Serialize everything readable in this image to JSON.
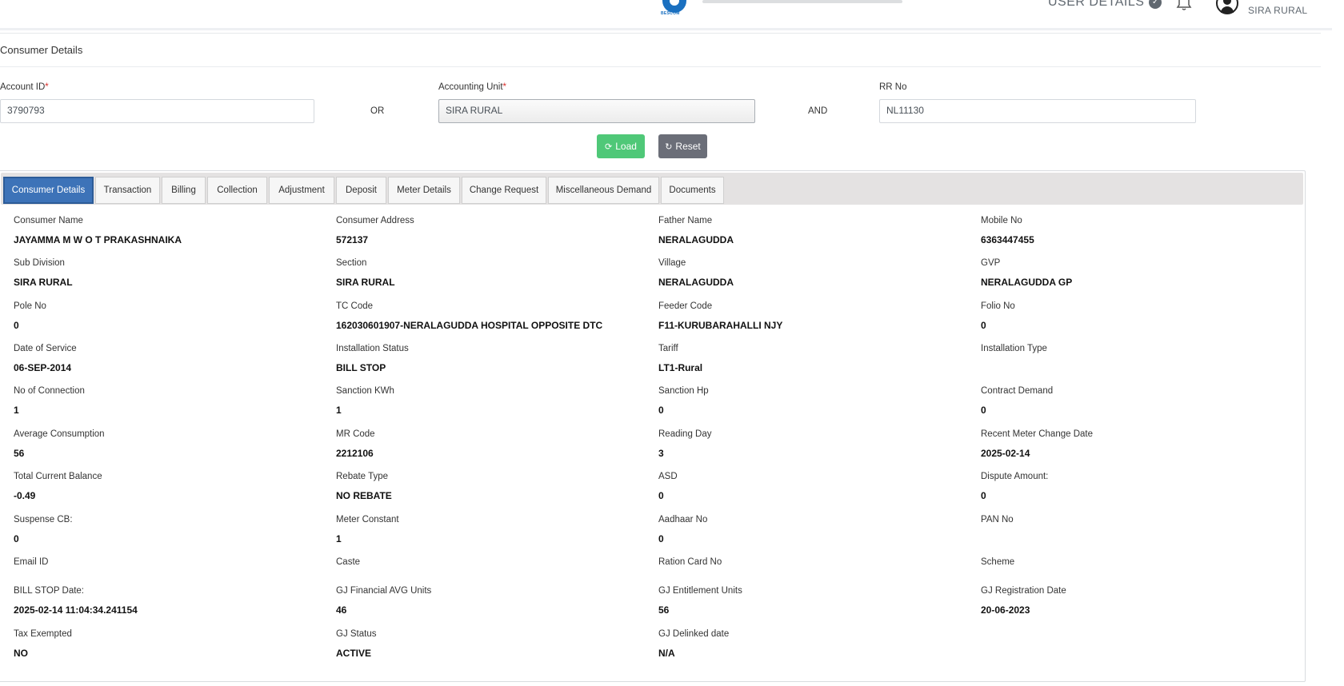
{
  "header": {
    "logo_tag": "BESCOM",
    "user_details_label": "USER DETAILS",
    "user_sub": "SIRA RURAL"
  },
  "page": {
    "title": "Consumer Details"
  },
  "search": {
    "account_id_label": "Account ID",
    "account_id_value": "3790793",
    "or_label": "OR",
    "accounting_unit_label": "Accounting Unit",
    "accounting_unit_value": "SIRA RURAL",
    "and_label": "AND",
    "rr_no_label": "RR No",
    "rr_no_value": "NL11130",
    "load_label": "Load",
    "reset_label": "Reset"
  },
  "tabs": [
    {
      "label": "Consumer Details",
      "active": true
    },
    {
      "label": "Transaction"
    },
    {
      "label": "Billing"
    },
    {
      "label": "Collection"
    },
    {
      "label": "Adjustment"
    },
    {
      "label": "Deposit"
    },
    {
      "label": "Meter Details"
    },
    {
      "label": "Change Request"
    },
    {
      "label": "Miscellaneous Demand"
    },
    {
      "label": "Documents"
    }
  ],
  "fields": [
    {
      "label": "Consumer Name",
      "value": "JAYAMMA M W O T PRAKASHNAIKA"
    },
    {
      "label": "Consumer Address",
      "value": "572137"
    },
    {
      "label": "Father Name",
      "value": "NERALAGUDDA"
    },
    {
      "label": "Mobile No",
      "value": "6363447455"
    },
    {
      "label": "Sub Division",
      "value": "SIRA RURAL"
    },
    {
      "label": "Section",
      "value": "SIRA RURAL"
    },
    {
      "label": "Village",
      "value": "NERALAGUDDA"
    },
    {
      "label": "GVP",
      "value": "NERALAGUDDA GP"
    },
    {
      "label": "Pole No",
      "value": "0"
    },
    {
      "label": "TC Code",
      "value": "162030601907-NERALAGUDDA HOSPITAL OPPOSITE DTC"
    },
    {
      "label": "Feeder Code",
      "value": "F11-KURUBARAHALLI NJY"
    },
    {
      "label": "Folio No",
      "value": "0"
    },
    {
      "label": "Date of Service",
      "value": "06-SEP-2014"
    },
    {
      "label": "Installation Status",
      "value": "BILL STOP"
    },
    {
      "label": "Tariff",
      "value": "LT1-Rural"
    },
    {
      "label": "Installation Type",
      "value": ""
    },
    {
      "label": "No of Connection",
      "value": "1"
    },
    {
      "label": "Sanction KWh",
      "value": "1"
    },
    {
      "label": "Sanction Hp",
      "value": "0"
    },
    {
      "label": "Contract Demand",
      "value": "0"
    },
    {
      "label": "Average Consumption",
      "value": "56"
    },
    {
      "label": "MR Code",
      "value": "2212106"
    },
    {
      "label": "Reading Day",
      "value": "3"
    },
    {
      "label": "Recent Meter Change Date",
      "value": "2025-02-14"
    },
    {
      "label": "Total Current Balance",
      "value": "-0.49"
    },
    {
      "label": "Rebate Type",
      "value": "NO REBATE"
    },
    {
      "label": "ASD",
      "value": "0"
    },
    {
      "label": "Dispute Amount:",
      "value": "0"
    },
    {
      "label": "Suspense CB:",
      "value": "0"
    },
    {
      "label": "Meter Constant",
      "value": "1"
    },
    {
      "label": "Aadhaar No",
      "value": "0"
    },
    {
      "label": "PAN No",
      "value": ""
    },
    {
      "label": "Email ID",
      "value": ""
    },
    {
      "label": "Caste",
      "value": ""
    },
    {
      "label": "Ration Card No",
      "value": ""
    },
    {
      "label": "Scheme",
      "value": ""
    },
    {
      "label": "BILL STOP Date:",
      "value": "2025-02-14 11:04:34.241154"
    },
    {
      "label": "GJ Financial AVG Units",
      "value": "46"
    },
    {
      "label": "GJ Entitlement Units",
      "value": "56"
    },
    {
      "label": "GJ Registration Date",
      "value": "20-06-2023"
    },
    {
      "label": "Tax Exempted",
      "value": "NO"
    },
    {
      "label": "GJ Status",
      "value": "ACTIVE"
    },
    {
      "label": "GJ Delinked date",
      "value": "N/A"
    }
  ]
}
